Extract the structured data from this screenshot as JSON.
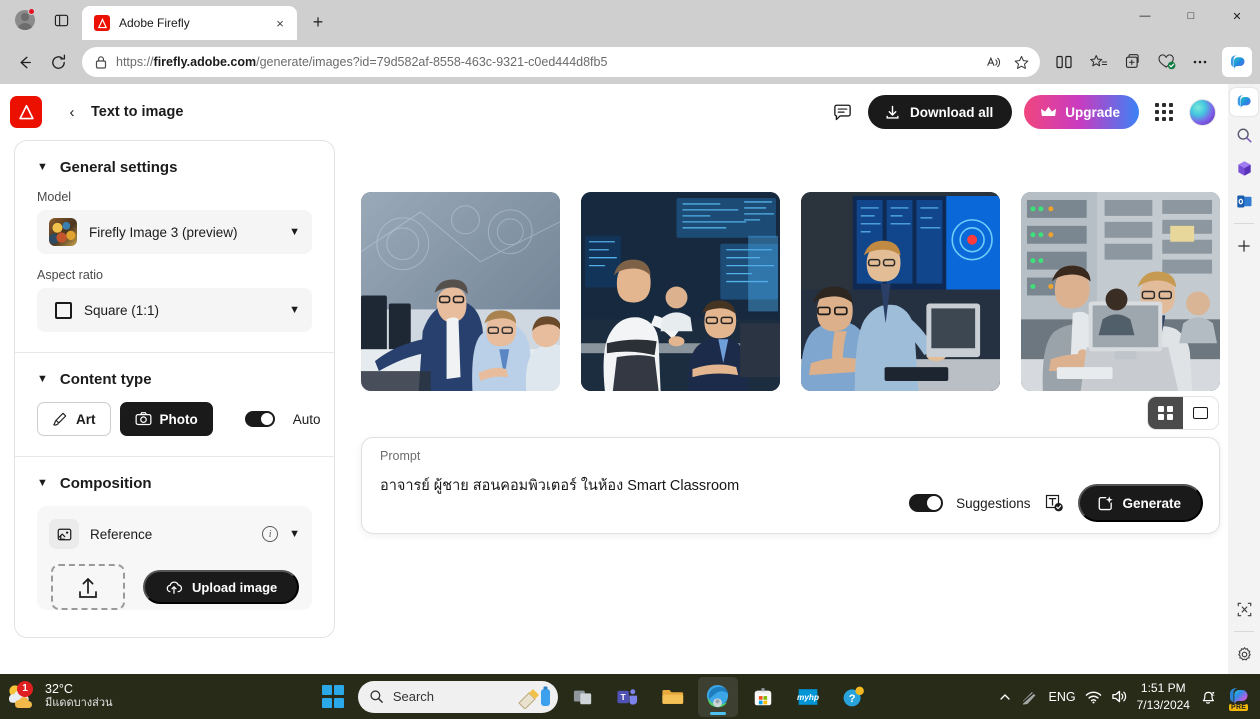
{
  "browser": {
    "tab": {
      "title": "Adobe Firefly",
      "favicon": "adobe-firefly-favicon",
      "close": "×"
    },
    "newtab_label": "+",
    "url": {
      "scheme": "https://",
      "domain": "firefly.adobe.com",
      "path": "/generate/images?id=79d582af-8558-463c-9321-c0ed444d8fb5"
    },
    "window_controls": {
      "minimize": "—",
      "maximize": "□",
      "close": "✕"
    },
    "toolbar_icons": [
      "back-icon",
      "refresh-icon",
      "lock-icon",
      "read-aloud-icon",
      "favorite-star-icon",
      "split-screen-icon",
      "favorites-icon",
      "collections-icon",
      "browser-essentials-icon",
      "settings-more-icon",
      "copilot-icon"
    ],
    "sidebar_icons": [
      "copilot-icon",
      "search-icon",
      "microsoft365-icon",
      "outlook-icon",
      "add-sidebar-icon",
      "screenshot-icon",
      "sidebar-settings-icon"
    ]
  },
  "app": {
    "logo": "adobe-logo",
    "back_label": "‹",
    "title": "Text to image",
    "feedback_icon": "feedback-icon",
    "download_all_label": "Download all",
    "upgrade_label": "Upgrade",
    "apps_grid_icon": "apps-grid-icon",
    "avatar": "user-avatar"
  },
  "settings": {
    "general": {
      "heading": "General settings",
      "model_label": "Model",
      "model_value": "Firefly Image 3 (preview)",
      "aspect_label": "Aspect ratio",
      "aspect_value": "Square (1:1)"
    },
    "content_type": {
      "heading": "Content type",
      "art_label": "Art",
      "photo_label": "Photo",
      "auto_label": "Auto",
      "selected": "Photo",
      "auto_on": true
    },
    "composition": {
      "heading": "Composition",
      "reference_label": "Reference",
      "upload_label": "Upload image"
    }
  },
  "results": {
    "view_modes": [
      "grid-view",
      "single-view"
    ],
    "active_view": "grid-view",
    "images": [
      {
        "alt": "instructor in navy suit assisting seated student at computer lab"
      },
      {
        "alt": "man in white shirt standing behind colleague at monitor wall"
      },
      {
        "alt": "bearded men working at computer workstations with blue screens"
      },
      {
        "alt": "two men looking at a desktop monitor in server room"
      }
    ]
  },
  "prompt": {
    "label": "Prompt",
    "value": "อาจารย์ ผู้ชาย สอนคอมพิวเตอร์ ในห้อง Smart Classroom",
    "suggestions_label": "Suggestions",
    "suggestions_on": true,
    "text_effects_icon": "text-effects-icon",
    "generate_label": "Generate"
  },
  "taskbar": {
    "weather": {
      "temp": "32°C",
      "desc": "มีแดดบางส่วน",
      "badge": "1"
    },
    "search_placeholder": "Search",
    "apps": [
      "task-view-icon",
      "teams-icon",
      "file-explorer-icon",
      "edge-icon",
      "microsoft-store-icon",
      "myhp-icon",
      "help-icon"
    ],
    "tray": {
      "language": "ENG",
      "time": "1:51 PM",
      "date": "7/13/2024"
    }
  },
  "colors": {
    "adobe_red": "#eb1000",
    "accent_dark": "#1a1a1a",
    "upgrade_gradient_start": "#f0467f",
    "upgrade_gradient_end": "#3b82f6",
    "taskbar_bg": "#272b18"
  }
}
